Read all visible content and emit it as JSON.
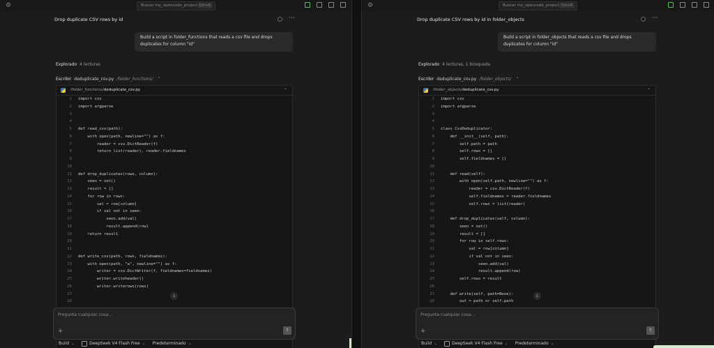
{
  "left": {
    "search_placeholder": "Buscar my_opencode_project",
    "search_shortcut": "Ctrl+K",
    "title": "Drop duplicate CSV rows by id",
    "user_message": "Build a script in folder_functions that reads a csv file and drops duplicates for column \"id\"",
    "explored_label": "Explorado",
    "explored_detail": "4 lecturas",
    "write_label": "Escribir",
    "write_file": "deduplicate_csv.py",
    "write_path": "/folder_functions/",
    "editor_dir": "/folder_functions/",
    "editor_file": "deduplicate_csv.py",
    "code": [
      "import csv",
      "import argparse",
      "",
      "",
      "def read_csv(path):",
      "    with open(path, newline=\"\") as f:",
      "        reader = csv.DictReader(f)",
      "        return list(reader), reader.fieldnames",
      "",
      "",
      "def drop_duplicates(rows, column):",
      "    seen = set()",
      "    result = []",
      "    for row in rows:",
      "        val = row[column]",
      "        if val not in seen:",
      "            seen.add(val)",
      "            result.append(row)",
      "    return result",
      "",
      "",
      "def write_csv(path, rows, fieldnames):",
      "    with open(path, \"w\", newline=\"\") as f:",
      "        writer = csv.DictWriter(f, fieldnames=fieldnames)",
      "        writer.writeheader()",
      "        writer.writerows(rows)",
      "",
      ""
    ],
    "composer_placeholder": "Pregunta cualquier cosa...",
    "mode": "Build",
    "model": "DeepSeek V4 Flash Free",
    "variant": "Predeterminado"
  },
  "right": {
    "search_placeholder": "Buscar my_opencode_project",
    "search_shortcut": "Ctrl+K",
    "title": "Drop duplicate CSV rows by id in folder_objects",
    "user_message": "Build a script in folder_objects that reads a csv file and drops duplicates for column \"id\"",
    "explored_label": "Explorado",
    "explored_detail": "4 lecturas, 1 búsqueda",
    "write_label": "Escribir",
    "write_file": "deduplicate_csv.py",
    "write_path": "/folder_objects/",
    "editor_dir": "/folder_objects/",
    "editor_file": "deduplicate_csv.py",
    "code": [
      "import csv",
      "import argparse",
      "",
      "",
      "class CsvDeduplicator:",
      "    def __init__(self, path):",
      "        self.path = path",
      "        self.rows = []",
      "        self.fieldnames = []",
      "",
      "    def read(self):",
      "        with open(self.path, newline=\"\") as f:",
      "            reader = csv.DictReader(f)",
      "            self.fieldnames = reader.fieldnames",
      "            self.rows = list(reader)",
      "",
      "    def drop_duplicates(self, column):",
      "        seen = set()",
      "        result = []",
      "        for row in self.rows:",
      "            val = row[column]",
      "            if val not in seen:",
      "                seen.add(val)",
      "                result.append(row)",
      "        self.rows = result",
      "",
      "    def write(self, path=None):",
      "        out = path or self.path"
    ],
    "composer_placeholder": "Pregunta cualquier cosa...",
    "mode": "Build",
    "model": "DeepSeek V4 Flash Free",
    "variant": "Predeterminado"
  }
}
